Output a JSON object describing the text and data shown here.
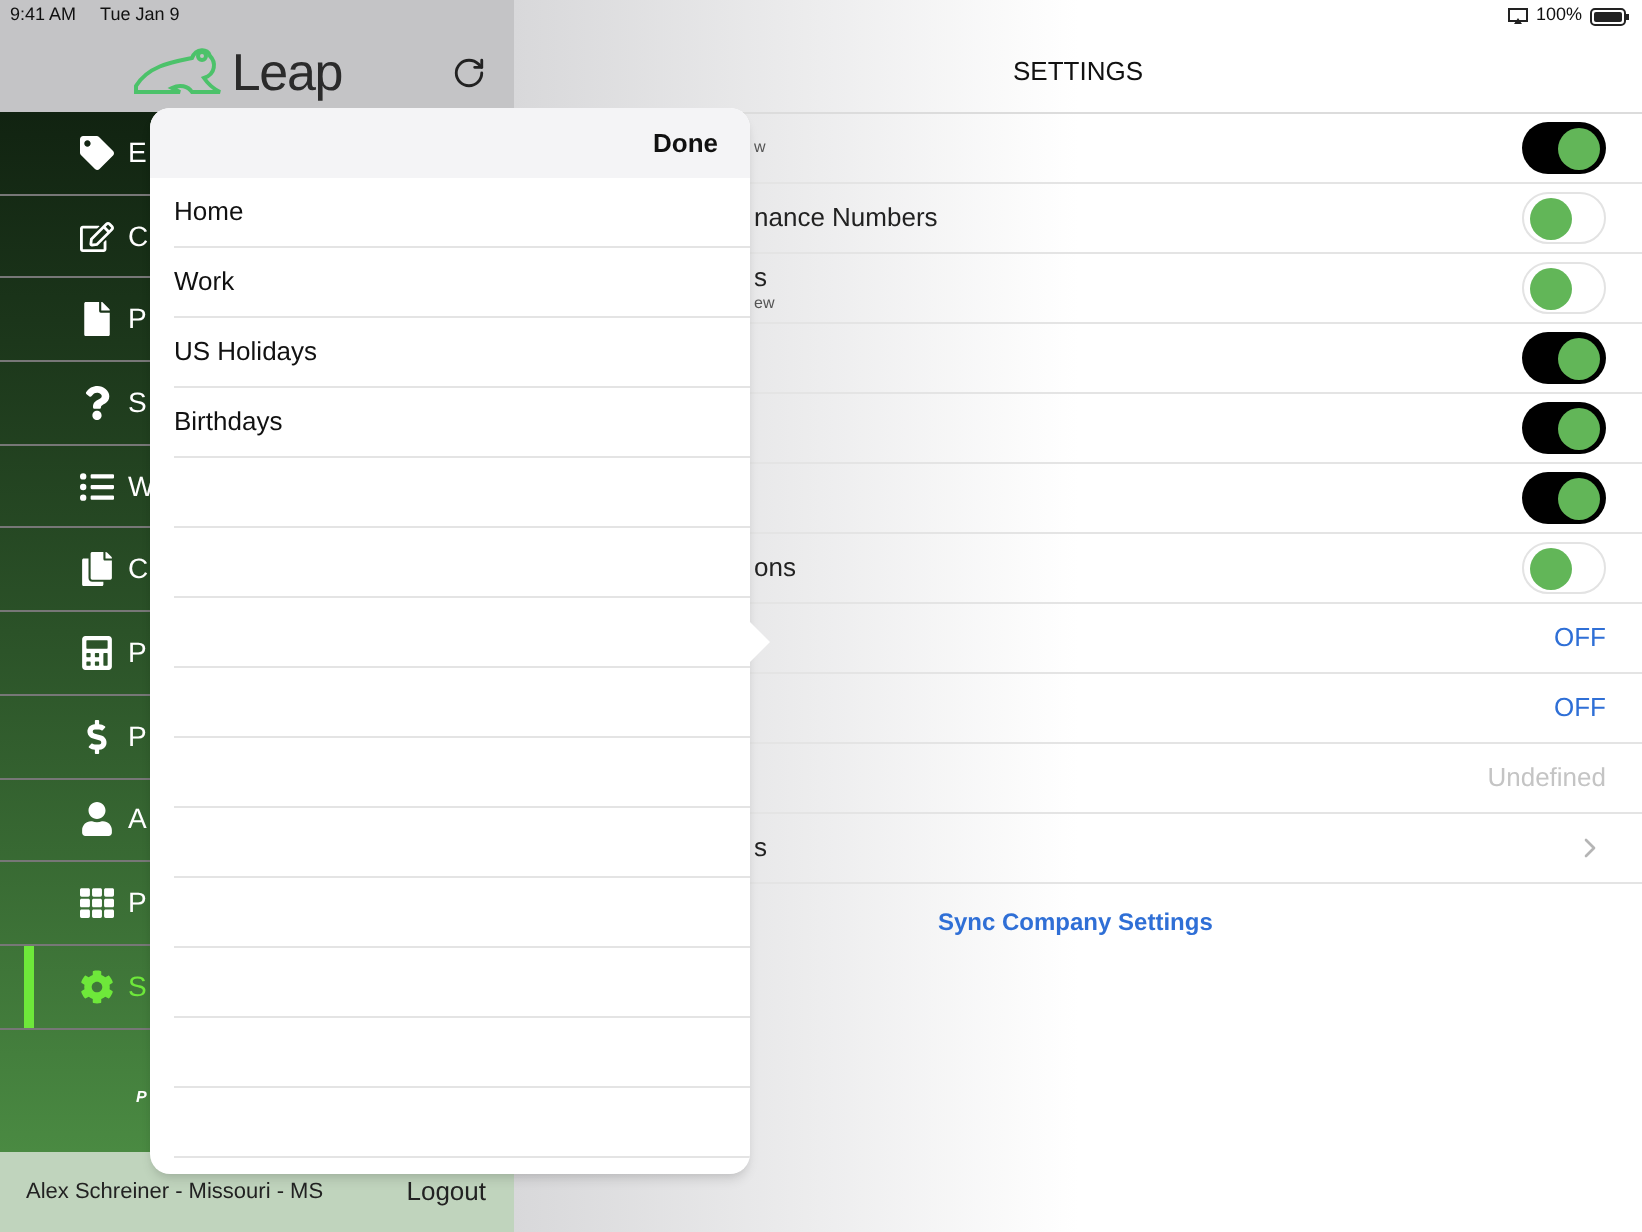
{
  "status_bar": {
    "time": "9:41 AM",
    "date": "Tue Jan 9",
    "battery": "100%"
  },
  "sidebar": {
    "logo": "Leap",
    "items": [
      {
        "label": "E",
        "selected": false
      },
      {
        "label": "C",
        "selected": false
      },
      {
        "label": "P",
        "selected": false
      },
      {
        "label": "S",
        "selected": false
      },
      {
        "label": "W",
        "selected": false
      },
      {
        "label": "C",
        "selected": false
      },
      {
        "label": "P",
        "selected": false
      },
      {
        "label": "P",
        "selected": false
      },
      {
        "label": "A",
        "selected": false
      },
      {
        "label": "P",
        "selected": false
      },
      {
        "label": "S",
        "selected": true
      }
    ],
    "fragment": "P",
    "user": "Alex Schreiner - Missouri - MS",
    "logout": "Logout"
  },
  "settings": {
    "title": "SETTINGS",
    "rows": [
      {
        "kind": "toggle",
        "sublabel": "w",
        "on": true
      },
      {
        "kind": "toggle",
        "label": "nance Numbers",
        "on": false
      },
      {
        "kind": "toggle",
        "label": "s",
        "sublabel": "ew",
        "on": false
      },
      {
        "kind": "toggle",
        "on": true
      },
      {
        "kind": "toggle",
        "on": true
      },
      {
        "kind": "toggle",
        "on": true
      },
      {
        "kind": "toggle",
        "label": "ons",
        "on": false
      },
      {
        "kind": "value",
        "value": "OFF",
        "dimmed": false
      },
      {
        "kind": "value",
        "value": "OFF",
        "dimmed": false
      },
      {
        "kind": "value",
        "value": "Undefined",
        "dimmed": true
      },
      {
        "kind": "link",
        "label": "s"
      }
    ],
    "sync": "Sync Company Settings"
  },
  "popover": {
    "done": "Done",
    "items": [
      "Home",
      "Work",
      "US Holidays",
      "Birthdays"
    ]
  }
}
